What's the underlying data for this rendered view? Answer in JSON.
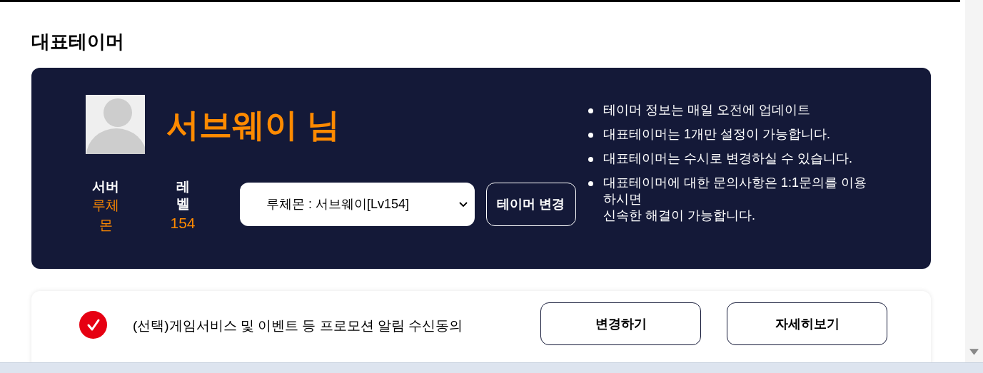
{
  "title": "대표테이머",
  "profile": {
    "name": "서브웨이 님",
    "server_label": "서버",
    "server_value": "루체몬",
    "level_label": "레벨",
    "level_value": "154"
  },
  "tamer_select": {
    "value": "루체몬 : 서브웨이[Lv154]"
  },
  "change_button": "테이머 변경",
  "notes": [
    {
      "lines": [
        "테이머 정보는 매일 오전에 업데이트"
      ]
    },
    {
      "lines": [
        "대표테이머는 1개만 설정이 가능합니다."
      ]
    },
    {
      "lines": [
        "대표테이머는 수시로 변경하실 수 있습니다."
      ]
    },
    {
      "lines": [
        "대표테이머에 대한 문의사항은 1:1문의를 이용 하시면",
        "신속한 해결이 가능합니다."
      ]
    }
  ],
  "consent": {
    "checked": true,
    "label": "(선택)게임서비스 및 이벤트 등 프로모션 알림 수신동의",
    "buttons": [
      "변경하기",
      "자세히보기"
    ]
  }
}
